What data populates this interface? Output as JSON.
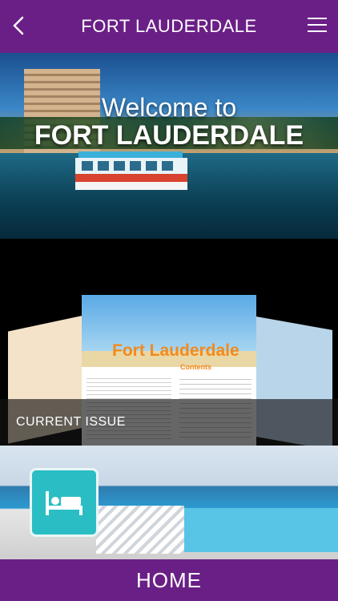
{
  "header": {
    "title": "FORT LAUDERDALE",
    "back_icon": "chevron-left-icon",
    "menu_icon": "hamburger-menu-icon"
  },
  "hero": {
    "line1": "Welcome to",
    "line2": "FORT LAUDERDALE"
  },
  "issue": {
    "label": "CURRENT ISSUE",
    "cover_title": "Fort Lauderdale",
    "cover_contents": "Contents"
  },
  "hotel": {
    "icon": "bed-icon",
    "tile_color": "#2bbdc4"
  },
  "footer": {
    "home_label": "HOME"
  },
  "colors": {
    "brand_purple": "#6a1f86"
  }
}
